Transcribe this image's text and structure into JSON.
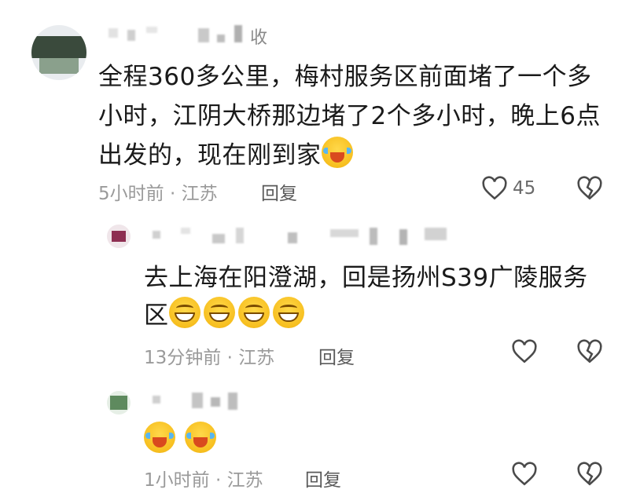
{
  "comments": [
    {
      "username": "收",
      "text_line1": "全程360多公里，梅村服务区前面堵了一个多",
      "text_line2": "小时，江阴大桥那边堵了2个多小时，晚上6点",
      "text_line3": "出发的，现在刚到家",
      "emoji": "cry-laugh-icon",
      "time_location": "5小时前 · 江苏",
      "reply_label": "回复",
      "like_count": "45"
    },
    {
      "text_line1": "去上海在阳澄湖，回是扬州S39广陵服务",
      "text_line2": "区",
      "emojis": [
        "grin-icon",
        "grin-icon",
        "grin-icon",
        "grin-icon"
      ],
      "time_location": "13分钟前 · 江苏",
      "reply_label": "回复"
    },
    {
      "emojis": [
        "cry-laugh-icon",
        "cry-laugh-icon"
      ],
      "time_location": "1小时前 · 江苏",
      "reply_label": "回复"
    }
  ]
}
